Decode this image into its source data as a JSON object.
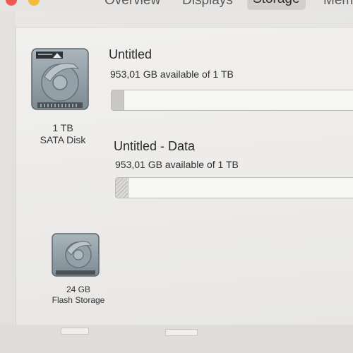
{
  "tabs": [
    {
      "label": "Overview"
    },
    {
      "label": "Displays"
    },
    {
      "label": "Storage"
    },
    {
      "label": "Mem"
    }
  ],
  "disks": [
    {
      "size": "1 TB",
      "type": "SATA Disk",
      "icon": "hard-disk-icon",
      "volumes": [
        {
          "name": "Untitled",
          "availability": "953,01 GB available of 1 TB",
          "used_fraction": 0.047
        },
        {
          "name": "Untitled - Data",
          "availability": "953,01 GB available of 1 TB",
          "used_fraction": 0.047
        }
      ]
    },
    {
      "size": "24 GB",
      "type": "Flash Storage",
      "icon": "hard-disk-icon"
    }
  ],
  "colors": {
    "close": "#ee5a52",
    "minimize": "#f4bc3e"
  }
}
